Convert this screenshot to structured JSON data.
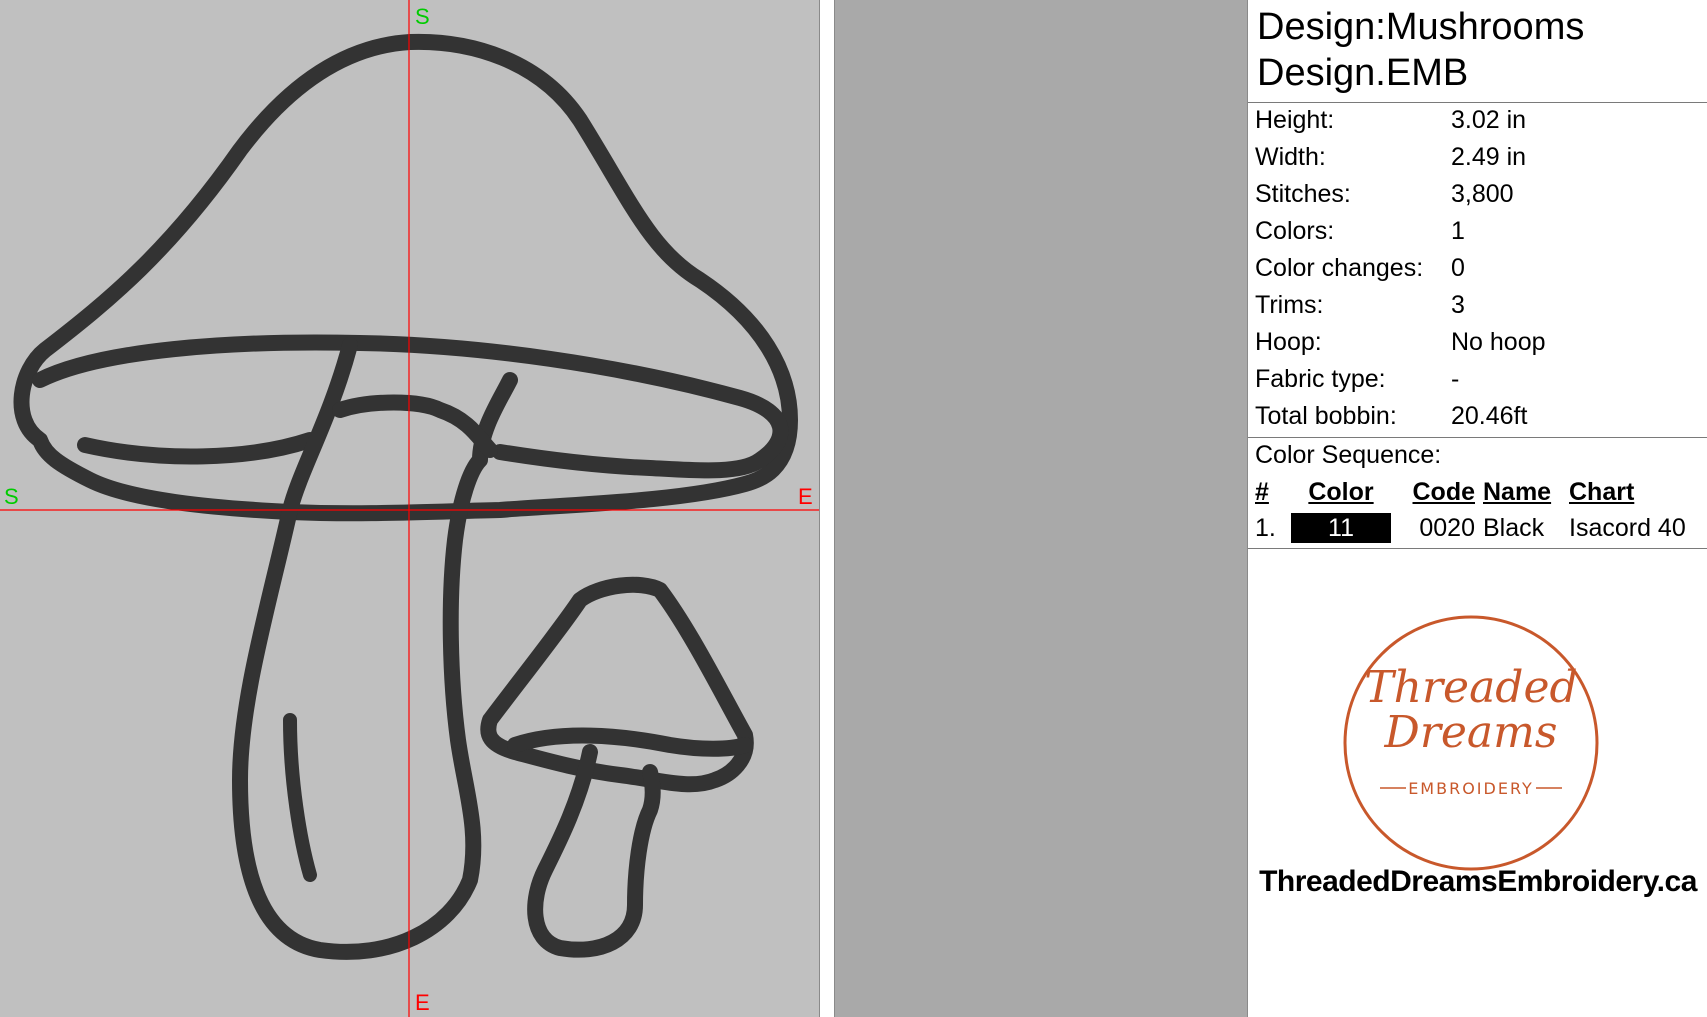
{
  "canvas": {
    "start_marker": "S",
    "end_marker": "E",
    "colors": {
      "background": "#c0c0c0",
      "thread": "#333333",
      "axis": "#ff0000",
      "start": "#00cc00"
    }
  },
  "panel": {
    "design_label": "Design:Mushrooms",
    "file_name": "Design.EMB",
    "properties": [
      {
        "label": "Height:",
        "value": "3.02 in"
      },
      {
        "label": "Width:",
        "value": "2.49 in"
      },
      {
        "label": "Stitches:",
        "value": "3,800"
      },
      {
        "label": "Colors:",
        "value": "1"
      },
      {
        "label": "Color changes:",
        "value": "0"
      },
      {
        "label": "Trims:",
        "value": "3"
      },
      {
        "label": "Hoop:",
        "value": "No hoop"
      },
      {
        "label": "Fabric type:",
        "value": "-"
      },
      {
        "label": "Total bobbin:",
        "value": "20.46ft"
      }
    ],
    "sequence_title": "Color Sequence:",
    "sequence_headers": {
      "num": "#",
      "color": "Color",
      "code": "Code",
      "name": "Name",
      "chart": "Chart"
    },
    "sequence_rows": [
      {
        "num": "1.",
        "color": "11",
        "code": "0020",
        "name": "Black",
        "chart": "Isacord 40",
        "swatch": "#000000"
      }
    ],
    "logo": {
      "line1": "Threaded",
      "line2": "Dreams",
      "line3": "EMBROIDERY",
      "color": "#c8582b"
    },
    "website": "ThreadedDreamsEmbroidery.ca"
  }
}
